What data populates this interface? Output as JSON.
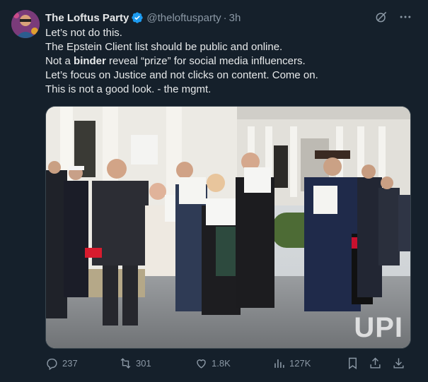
{
  "author": {
    "display_name": "The Loftus Party",
    "handle": "@theloftusparty",
    "separator": "·",
    "time": "3h",
    "verified_color": "#1d9bf0"
  },
  "post": {
    "line1": "Let’s not do this.",
    "line2": "The Epstein Client list should be public and online.",
    "line3_before": "Not a ",
    "line3_bold": "binder",
    "line3_after": " reveal “prize” for social media influencers.",
    "line4": "Let’s focus on Justice and not clicks on content. Come on.",
    "line5": "This is not a good look. - the mgmt."
  },
  "media": {
    "watermark": "UPI"
  },
  "actions": {
    "replies": "237",
    "reposts": "301",
    "likes": "1.8K",
    "views": "127K"
  },
  "icons": [
    "grok-icon",
    "more-icon",
    "reply-icon",
    "repost-icon",
    "like-icon",
    "views-icon",
    "bookmark-icon",
    "share-icon",
    "download-icon"
  ],
  "colors": {
    "background": "#15202b",
    "text": "#e7e9ea",
    "muted": "#8b98a5",
    "accent": "#1d9bf0"
  }
}
